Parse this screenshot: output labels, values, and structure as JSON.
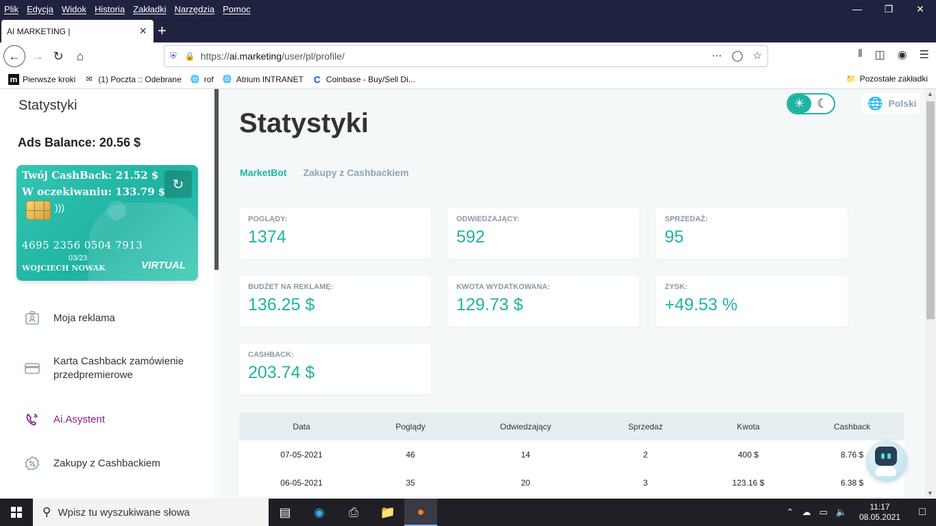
{
  "browser": {
    "menu": [
      "Plik",
      "Edycja",
      "Widok",
      "Historia",
      "Zakładki",
      "Narzędzia",
      "Pomoc"
    ],
    "tab_title": "AI MARKETING |",
    "url_prefix": "https://",
    "url_domain": "ai.marketing",
    "url_path": "/user/pl/profile/",
    "bookmarks": [
      {
        "label": "Pierwsze kroki",
        "icon": "m-logo-icon"
      },
      {
        "label": "(1) Poczta :: Odebrane",
        "icon": "mail-icon"
      },
      {
        "label": "rof",
        "icon": "globe-icon"
      },
      {
        "label": "Atrium INTRANET",
        "icon": "globe-icon"
      },
      {
        "label": "Coinbase - Buy/Sell Di...",
        "icon": "coinbase-icon"
      }
    ],
    "other_bookmarks": "Pozostałe zakładki"
  },
  "sidebar": {
    "title": "Statystyki",
    "ads_balance": "Ads Balance: 20.56 $",
    "card": {
      "cashback": "Twój CashBack: 21.52 $",
      "pending": "W oczekiwaniu: 133.79 $",
      "number": "4695 2356 0504 7913",
      "expiry": "03/23",
      "holder": "WOJCIECH NOWAK",
      "type": "VIRTUAL"
    },
    "nav": [
      {
        "label": "Moja reklama",
        "icon": "id-badge-icon"
      },
      {
        "label": "Karta Cashback zamówienie przedpremierowe",
        "icon": "credit-card-icon"
      },
      {
        "label": "Ai.Asystent",
        "icon": "phone-signal-icon"
      },
      {
        "label": "Zakupy z Cashbackiem",
        "icon": "percent-badge-icon"
      }
    ]
  },
  "main": {
    "title": "Statystyki",
    "language": "Polski",
    "tabs": [
      {
        "label": "MarketBot",
        "active": true
      },
      {
        "label": "Zakupy z Cashbackiem",
        "active": false
      }
    ],
    "stats": [
      {
        "label": "POGLĄDY:",
        "value": "1374"
      },
      {
        "label": "ODWIEDZAJĄCY:",
        "value": "592"
      },
      {
        "label": "SPRZEDAŻ:",
        "value": "95"
      },
      {
        "label": "BUDŻET NA REKLAMĘ:",
        "value": "136.25 $"
      },
      {
        "label": "KWOTA WYDATKOWANA:",
        "value": "129.73 $"
      },
      {
        "label": "ZYSK:",
        "value": "+49.53 %"
      },
      {
        "label": "CASHBACK:",
        "value": "203.74 $"
      }
    ],
    "table": {
      "headers": [
        "Data",
        "Poglądy",
        "Odwiedzający",
        "Sprzedaż",
        "Kwota",
        "Cashback"
      ],
      "rows": [
        [
          "07-05-2021",
          "46",
          "14",
          "2",
          "400 $",
          "8.76 $"
        ],
        [
          "06-05-2021",
          "35",
          "20",
          "3",
          "123.16 $",
          "6.38 $"
        ]
      ]
    },
    "accent_color": "#1fb3a2",
    "active_nav_color": "#8a1c8f"
  },
  "taskbar": {
    "search_placeholder": "Wpisz tu wyszukiwane słowa",
    "time": "11:17",
    "date": "08.05.2021"
  }
}
